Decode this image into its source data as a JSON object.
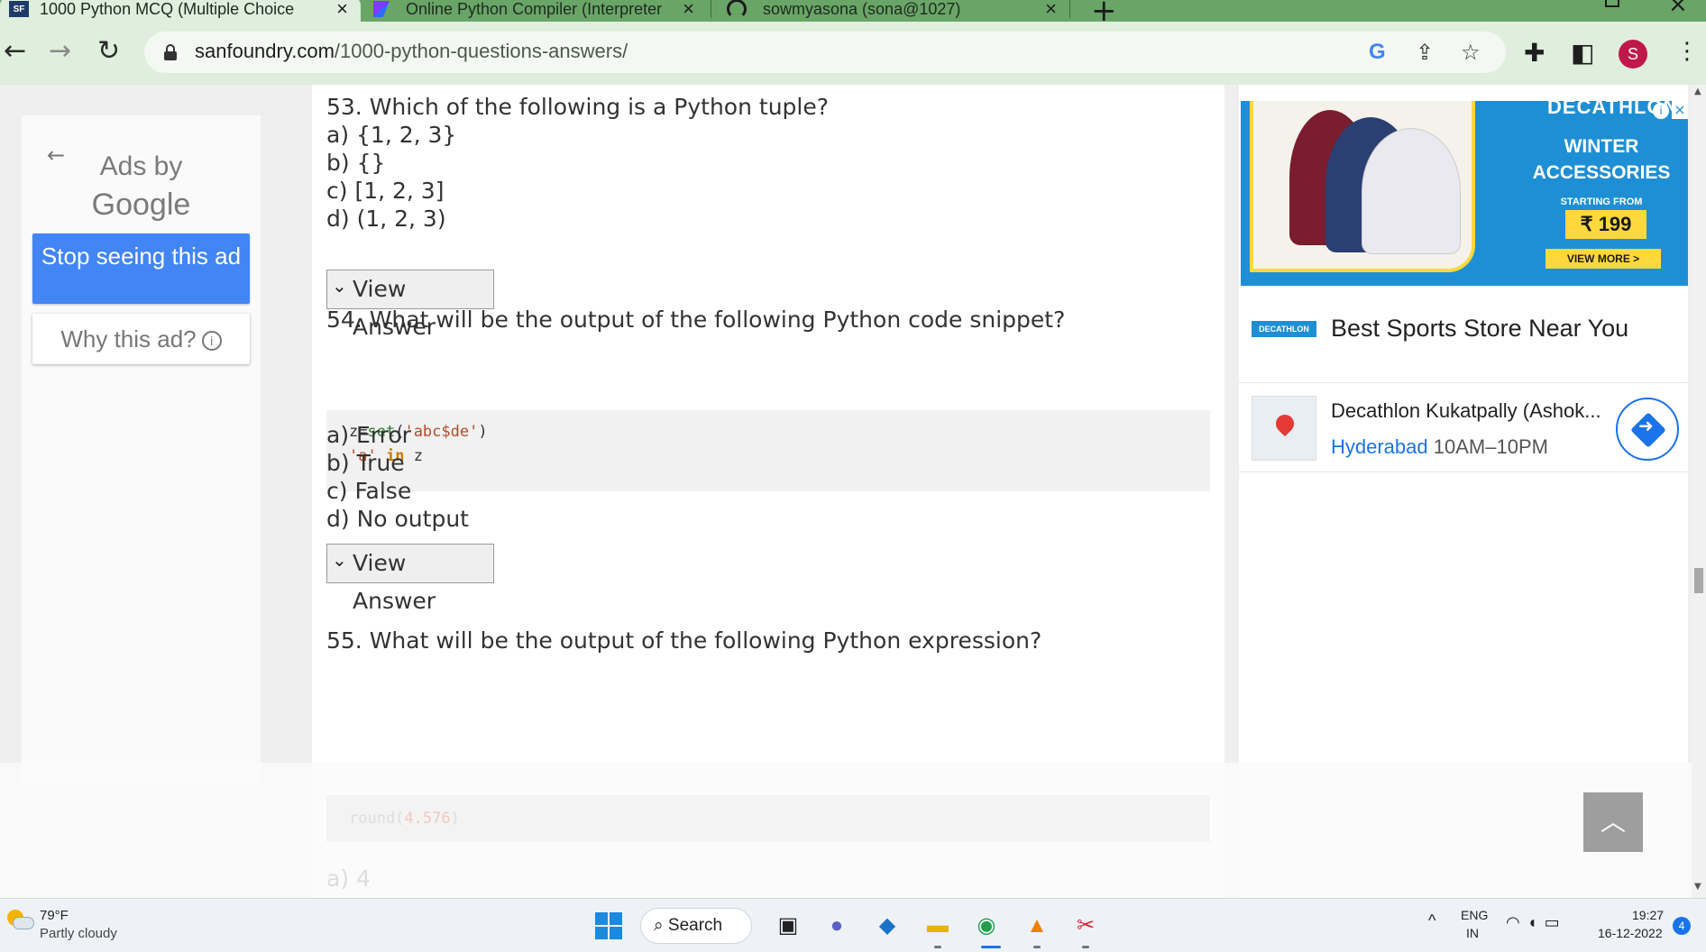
{
  "browser": {
    "tabs": [
      {
        "title": "1000 Python MCQ (Multiple Choice",
        "icon": "sanfoundry-favicon"
      },
      {
        "title": "Online Python Compiler (Interpreter",
        "icon": "programiz-favicon"
      },
      {
        "title": "sowmyasona (sona@1027)",
        "icon": "github-favicon"
      }
    ],
    "url_domain": "sanfoundry.com",
    "url_path": "/1000-python-questions-answers/",
    "profile_initial": "S"
  },
  "left_ad": {
    "ads_by": "Ads by",
    "google": "Google",
    "stop_label": "Stop seeing this ad",
    "why_label": "Why this ad?"
  },
  "questions": {
    "q53": {
      "text": "53. Which of the following is a Python tuple?",
      "options": [
        "a) {1, 2, 3}",
        "b) {}",
        "c) [1, 2, 3]",
        "d) (1, 2, 3)"
      ],
      "view_answer": "View Answer"
    },
    "q54": {
      "text": "54. What will be the output of the following Python code snippet?",
      "code": {
        "line1": {
          "var": "z=",
          "fn": "set",
          "open": "(",
          "str": "'abc$de'",
          "close": ")"
        },
        "line2": {
          "str": "'a'",
          "kw": "in",
          "var": "z"
        }
      },
      "options": [
        "a) Error",
        "b) True",
        "c) False",
        "d) No output"
      ],
      "view_answer": "View Answer"
    },
    "q55": {
      "text": "55. What will be the output of the following Python expression?",
      "code_fn": "round(",
      "code_num": "4.576",
      "code_close": ")",
      "option_a": "a) 4"
    }
  },
  "right_ad": {
    "brand": "DECATHLON",
    "headline": "WINTER ACCESSORIES",
    "starting_from": "STARTING FROM",
    "price": "₹ 199",
    "view_more": "VIEW MORE >",
    "logo_text": "DECATHLON",
    "title": "Best Sports Store Near You",
    "store_name": "Decathlon Kukatpally (Ashok...",
    "store_city": "Hyderabad",
    "store_hours": "10AM–10PM"
  },
  "taskbar": {
    "temp": "79°F",
    "condition": "Partly cloudy",
    "search": "Search",
    "lang1": "ENG",
    "lang2": "IN",
    "time": "19:27",
    "date": "16-12-2022",
    "notifications": "4"
  },
  "colors": {
    "tab_strip": "#6aa568",
    "toolbar": "#dfeedd",
    "ad_blue": "#4285f4",
    "decathlon_blue": "#1e8fd4",
    "decathlon_yellow": "#ffd93b"
  }
}
